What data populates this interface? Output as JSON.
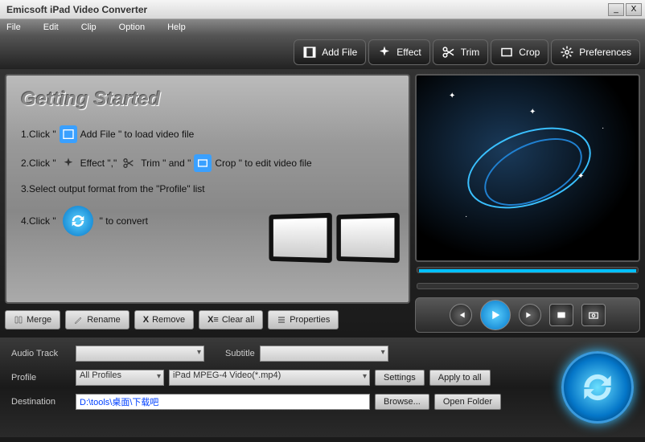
{
  "window": {
    "title": "Emicsoft iPad Video Converter"
  },
  "menu": {
    "file": "File",
    "edit": "Edit",
    "clip": "Clip",
    "option": "Option",
    "help": "Help"
  },
  "toolbar": {
    "addfile": "Add File",
    "effect": "Effect",
    "trim": "Trim",
    "crop": "Crop",
    "prefs": "Preferences"
  },
  "guide": {
    "heading": "Getting Started",
    "s1a": "1.Click \" ",
    "s1b": " Add File \"  to load video file",
    "s2a": "2.Click \" ",
    "s2eff": " Effect \",\" ",
    "s2trim": " Trim \" and \" ",
    "s2crop": " Crop \" to edit video file",
    "s3": "3.Select output format from the \"Profile\" list",
    "s4a": "4.Click \" ",
    "s4b": " \" to convert"
  },
  "listbtns": {
    "merge": "Merge",
    "rename": "Rename",
    "remove": "Remove",
    "clearall": "Clear all",
    "properties": "Properties"
  },
  "tracks": {
    "audiolbl": "Audio Track",
    "subtitlelbl": "Subtitle"
  },
  "profile": {
    "lbl": "Profile",
    "cat": "All Profiles",
    "fmt": "iPad MPEG-4 Video(*.mp4)",
    "settings": "Settings",
    "applyall": "Apply to all"
  },
  "dest": {
    "lbl": "Destination",
    "path": "D:\\tools\\桌面\\下载吧",
    "browse": "Browse...",
    "openfolder": "Open Folder"
  }
}
